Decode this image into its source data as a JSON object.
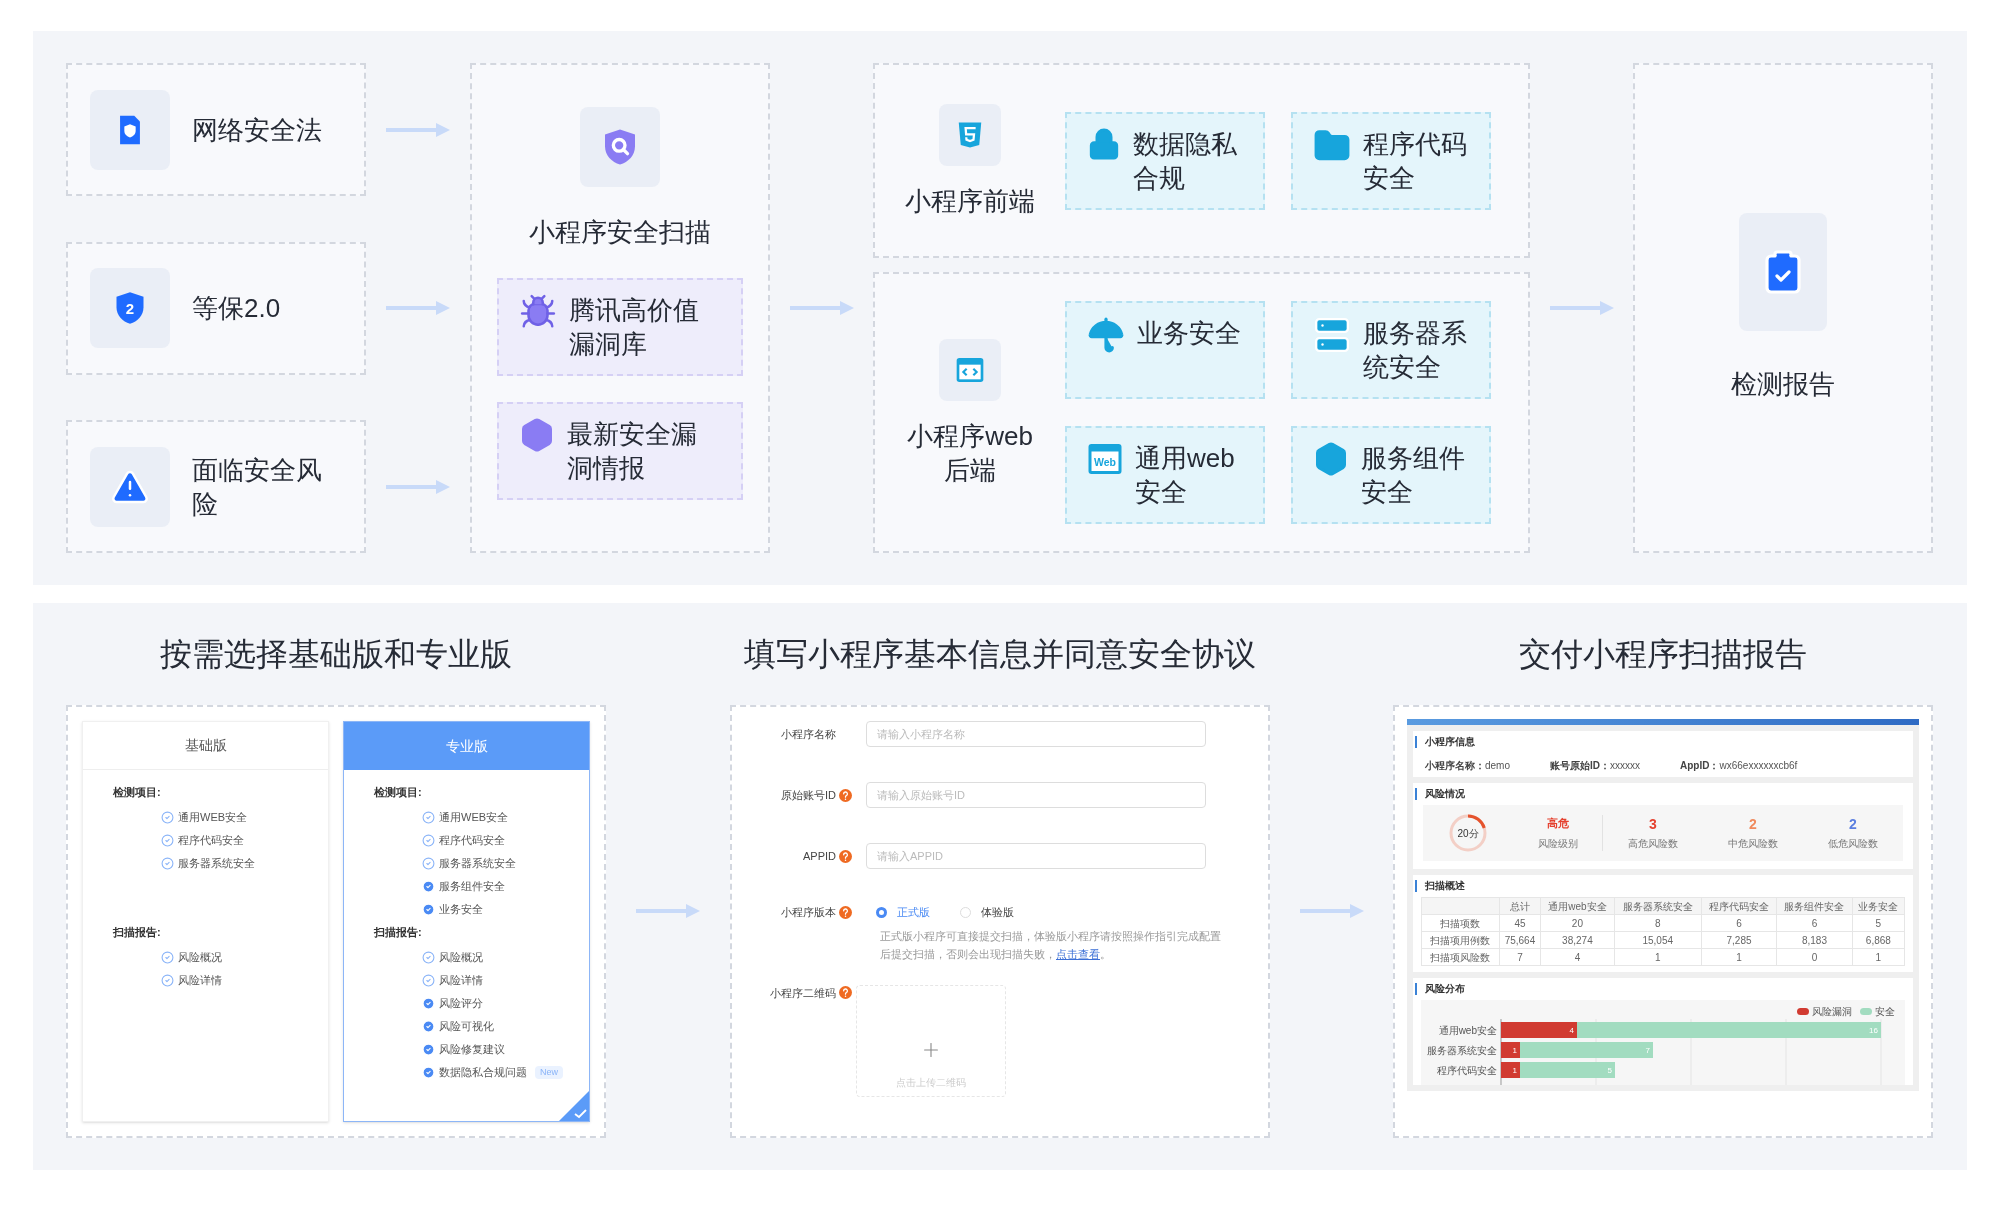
{
  "flow": {
    "sources": [
      {
        "label": "网络安全法"
      },
      {
        "label": "等保2.0",
        "icon_text": "2"
      },
      {
        "label": "面临安全风险"
      }
    ],
    "scan": {
      "title": "小程序安全扫描",
      "items": [
        {
          "label": "腾讯高价值漏洞库"
        },
        {
          "label": "最新安全漏洞情报"
        }
      ]
    },
    "frontend": {
      "title": "小程序前端",
      "items": [
        {
          "label": "数据隐私合规"
        },
        {
          "label": "程序代码安全"
        }
      ]
    },
    "backend": {
      "title": "小程序web后端",
      "items": [
        {
          "label": "业务安全"
        },
        {
          "label": "服务器系统安全"
        },
        {
          "label": "通用web安全",
          "icon_text": "Web"
        },
        {
          "label": "服务组件安全"
        }
      ]
    },
    "report": {
      "title": "检测报告"
    }
  },
  "plan_step": {
    "title": "按需选择基础版和专业版",
    "plans": [
      {
        "name": "基础版",
        "selected": false,
        "sections": [
          {
            "title": "检测项目:",
            "items": [
              {
                "label": "通用WEB安全",
                "extra": false
              },
              {
                "label": "程序代码安全",
                "extra": false
              },
              {
                "label": "服务器系统安全",
                "extra": false
              }
            ]
          },
          {
            "title": "扫描报告:",
            "items": [
              {
                "label": "风险概况",
                "extra": false
              },
              {
                "label": "风险详情",
                "extra": false
              }
            ]
          }
        ]
      },
      {
        "name": "专业版",
        "selected": true,
        "sections": [
          {
            "title": "检测项目:",
            "items": [
              {
                "label": "通用WEB安全",
                "extra": false
              },
              {
                "label": "程序代码安全",
                "extra": false
              },
              {
                "label": "服务器系统安全",
                "extra": false
              },
              {
                "label": "服务组件安全",
                "extra": true
              },
              {
                "label": "业务安全",
                "extra": true
              }
            ]
          },
          {
            "title": "扫描报告:",
            "items": [
              {
                "label": "风险概况",
                "extra": false
              },
              {
                "label": "风险详情",
                "extra": false
              },
              {
                "label": "风险评分",
                "extra": true
              },
              {
                "label": "风险可视化",
                "extra": true
              },
              {
                "label": "风险修复建议",
                "extra": true
              },
              {
                "label": "数据隐私合规问题",
                "extra": true,
                "badge": "New"
              }
            ]
          }
        ]
      }
    ]
  },
  "form_step": {
    "title": "填写小程序基本信息并同意安全协议",
    "fields": [
      {
        "label": "小程序名称",
        "help": false,
        "placeholder": "请输入小程序名称"
      },
      {
        "label": "原始账号ID",
        "help": true,
        "placeholder": "请输入原始账号ID"
      },
      {
        "label": "APPID",
        "help": true,
        "placeholder": "请输入APPID"
      }
    ],
    "version": {
      "label": "小程序版本",
      "help": true,
      "options": [
        {
          "label": "正式版",
          "selected": true
        },
        {
          "label": "体验版",
          "selected": false
        }
      ]
    },
    "note": "正式版小程序可直接提交扫描，体验版小程序请按照操作指引完成配置后提交扫描，否则会出现扫描失败，",
    "note_link": "点击查看",
    "note_end": "。",
    "upload": {
      "label": "小程序二维码",
      "help": true,
      "hint": "点击上传二维码"
    }
  },
  "report_step": {
    "title": "交付小程序扫描报告",
    "info": {
      "title": "小程序信息",
      "fields": [
        {
          "label": "小程序名称：",
          "value": "demo"
        },
        {
          "label": "账号原始ID：",
          "value": "xxxxxx"
        },
        {
          "label": "AppID：",
          "value": "wx66exxxxxxcb6f"
        }
      ]
    },
    "risk": {
      "title": "风险情况",
      "score": "20分",
      "level": 0.2,
      "risk_level": "高危",
      "risk_level_label": "风险级别",
      "counts": [
        {
          "value": "3",
          "label": "高危风险数",
          "color": "#e5412f"
        },
        {
          "value": "2",
          "label": "中危风险数",
          "color": "#f08a5d"
        },
        {
          "value": "2",
          "label": "低危风险数",
          "color": "#5b7fe0"
        }
      ]
    },
    "overview": {
      "title": "扫描概述",
      "columns": [
        "总计",
        "通用web安全",
        "服务器系统安全",
        "程序代码安全",
        "服务组件安全",
        "业务安全"
      ],
      "rows": [
        {
          "label": "扫描项数",
          "cells": [
            "45",
            "20",
            "8",
            "6",
            "6",
            "5"
          ]
        },
        {
          "label": "扫描项用例数",
          "cells": [
            "75,664",
            "38,274",
            "15,054",
            "7,285",
            "8,183",
            "6,868"
          ]
        },
        {
          "label": "扫描项风险数",
          "cells": [
            "7",
            "4",
            "1",
            "1",
            "0",
            "1"
          ]
        }
      ]
    },
    "distribution": {
      "title": "风险分布",
      "chart_data": {
        "type": "bar",
        "orientation": "horizontal",
        "stacked": true,
        "data_labels": true,
        "categories": [
          "通用web安全",
          "服务器系统安全",
          "程序代码安全"
        ],
        "xlim": [
          0,
          20
        ],
        "series": [
          {
            "name": "风险漏洞",
            "color": "#d13b31",
            "values": [
              4,
              1,
              1
            ]
          },
          {
            "name": "安全",
            "color": "#a2dcc0",
            "values": [
              16,
              7,
              5
            ]
          }
        ]
      }
    }
  }
}
